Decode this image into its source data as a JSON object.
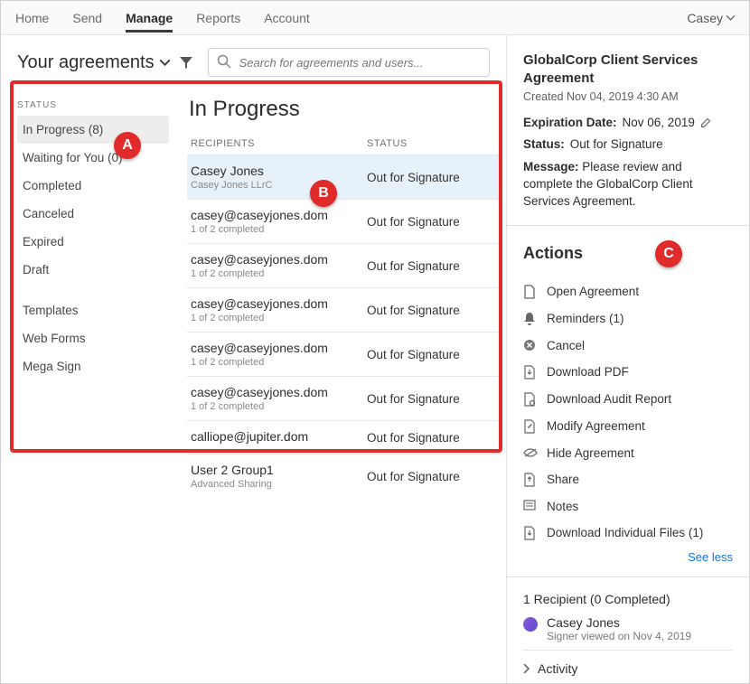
{
  "nav": {
    "items": [
      "Home",
      "Send",
      "Manage",
      "Reports",
      "Account"
    ],
    "active": "Manage",
    "user": "Casey"
  },
  "header": {
    "your_agreements": "Your agreements",
    "search_placeholder": "Search for agreements and users..."
  },
  "sidebar": {
    "status_header": "STATUS",
    "items": [
      {
        "label": "In Progress (8)",
        "selected": true
      },
      {
        "label": "Waiting for You (0)"
      },
      {
        "label": "Completed"
      },
      {
        "label": "Canceled"
      },
      {
        "label": "Expired"
      },
      {
        "label": "Draft"
      }
    ],
    "more": [
      {
        "label": "Templates"
      },
      {
        "label": "Web Forms"
      },
      {
        "label": "Mega Sign"
      }
    ]
  },
  "list": {
    "title": "In Progress",
    "col_recipients": "RECIPIENTS",
    "col_status": "STATUS",
    "rows": [
      {
        "name": "Casey Jones",
        "sub": "Casey Jones LLrC",
        "status": "Out for Signature",
        "selected": true
      },
      {
        "name": "casey@caseyjones.dom",
        "sub": "1 of 2 completed",
        "status": "Out for Signature"
      },
      {
        "name": "casey@caseyjones.dom",
        "sub": "1 of 2 completed",
        "status": "Out for Signature"
      },
      {
        "name": "casey@caseyjones.dom",
        "sub": "1 of 2 completed",
        "status": "Out for Signature"
      },
      {
        "name": "casey@caseyjones.dom",
        "sub": "1 of 2 completed",
        "status": "Out for Signature"
      },
      {
        "name": "casey@caseyjones.dom",
        "sub": "1 of 2 completed",
        "status": "Out for Signature"
      },
      {
        "name": "calliope@jupiter.dom",
        "sub": "",
        "status": "Out for Signature"
      },
      {
        "name": "User 2 Group1",
        "sub": "Advanced Sharing",
        "status": "Out for Signature"
      }
    ]
  },
  "details": {
    "title": "GlobalCorp Client Services Agreement",
    "created": "Created Nov 04, 2019 4:30 AM",
    "expiration_label": "Expiration Date:",
    "expiration_value": "Nov 06, 2019",
    "status_label": "Status:",
    "status_value": "Out for Signature",
    "message_label": "Message:",
    "message_value": "Please review and complete the GlobalCorp Client Services Agreement.",
    "actions_title": "Actions",
    "actions": [
      {
        "icon": "file",
        "label": "Open Agreement"
      },
      {
        "icon": "bell",
        "label": "Reminders (1)"
      },
      {
        "icon": "x",
        "label": "Cancel"
      },
      {
        "icon": "download",
        "label": "Download PDF"
      },
      {
        "icon": "audit",
        "label": "Download Audit Report"
      },
      {
        "icon": "edit",
        "label": "Modify Agreement"
      },
      {
        "icon": "hide",
        "label": "Hide Agreement"
      },
      {
        "icon": "share",
        "label": "Share"
      },
      {
        "icon": "notes",
        "label": "Notes"
      },
      {
        "icon": "files",
        "label": "Download Individual Files (1)"
      }
    ],
    "see_less": "See less",
    "recipients_header": "1 Recipient (0 Completed)",
    "recipient_name": "Casey Jones",
    "recipient_sub": "Signer viewed on Nov 4, 2019",
    "activity": "Activity"
  },
  "badges": {
    "A": "A",
    "B": "B",
    "C": "C"
  }
}
